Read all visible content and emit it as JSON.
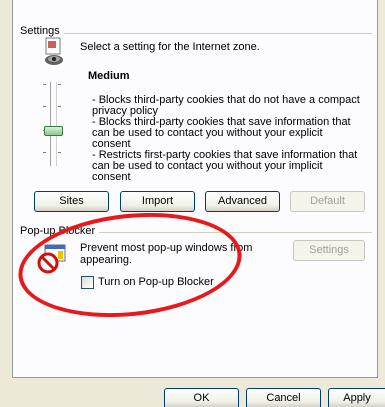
{
  "settings": {
    "group_title": "Settings",
    "select_text": "Select a setting for the Internet zone.",
    "level": "Medium",
    "descriptions": [
      "- Blocks third-party cookies that do not have a compact privacy policy",
      "- Blocks third-party cookies that save information that can be used to contact you without your explicit consent",
      "- Restricts first-party cookies that save information that can be used to contact you without your implicit consent"
    ],
    "buttons": {
      "sites": "Sites",
      "import": "Import",
      "advanced": "Advanced",
      "default": "Default"
    }
  },
  "popup": {
    "group_title": "Pop-up Blocker",
    "text": "Prevent most pop-up windows from appearing.",
    "checkbox_label": "Turn on Pop-up Blocker",
    "checkbox_checked": false,
    "settings_button": "Settings"
  },
  "footer": {
    "ok": "OK",
    "cancel": "Cancel",
    "apply": "Apply"
  },
  "colors": {
    "annotation_ellipse": "#e8181b",
    "button_border": "#003c74",
    "dialog_background": "#ece9d8"
  }
}
